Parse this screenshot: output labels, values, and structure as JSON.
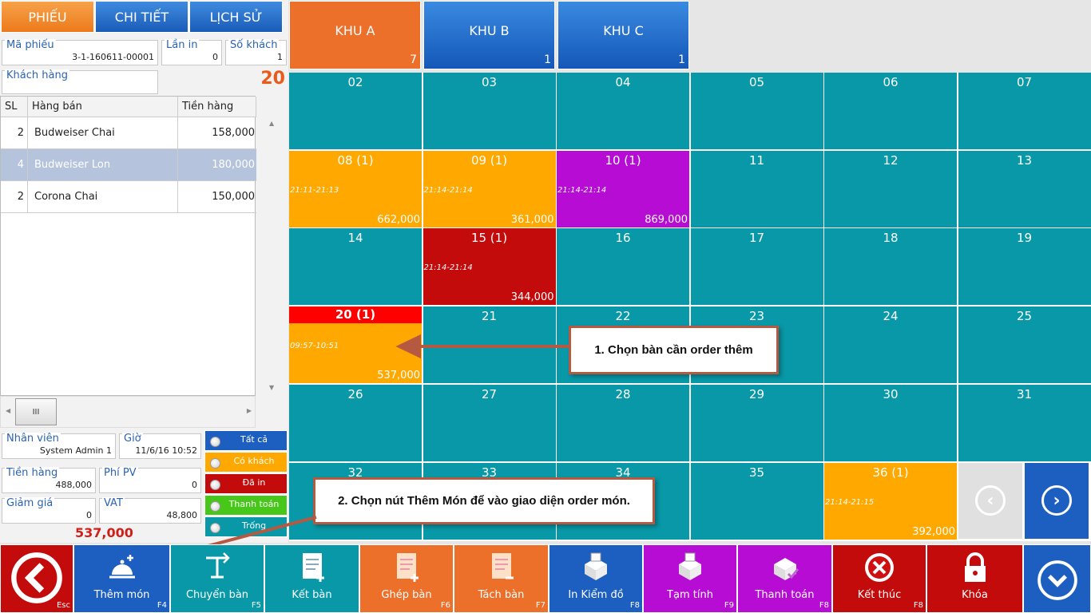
{
  "tabs": [
    {
      "label": "PHIẾU",
      "active": true
    },
    {
      "label": "CHI TIẾT"
    },
    {
      "label": "LỊCH SỬ"
    }
  ],
  "ticket": {
    "ma_phieu_label": "Mã phiếu",
    "ma_phieu": "3-1-160611-00001",
    "lan_in_label": "Lần in",
    "lan_in": "0",
    "so_khach_label": "Số khách",
    "so_khach": "1",
    "khach_hang_label": "Khách hàng",
    "khach_hang": "",
    "table_number": "20"
  },
  "items": {
    "headers": {
      "qty": "SL",
      "name": "Hàng bán",
      "amount": "Tiền hàng"
    },
    "rows": [
      {
        "qty": "2",
        "name": "Budweiser Chai",
        "amount": "158,000"
      },
      {
        "qty": "4",
        "name": "Budweiser Lon",
        "amount": "180,000",
        "selected": true
      },
      {
        "qty": "2",
        "name": "Corona Chai",
        "amount": "150,000"
      }
    ],
    "scroll_handle": "III"
  },
  "summary": {
    "nhan_vien_label": "Nhân viên",
    "nhan_vien": "System Admin 1",
    "gio_label": "Giờ",
    "gio": "11/6/16 10:52",
    "tien_hang_label": "Tiền hàng",
    "tien_hang": "488,000",
    "phi_pv_label": "Phí PV",
    "phi_pv": "0",
    "giam_gia_label": "Giảm giá",
    "giam_gia": "0",
    "vat_label": "VAT",
    "vat": "48,800",
    "total": "537,000"
  },
  "filters": [
    {
      "label": "Tất cả",
      "color": "#1d5fc0"
    },
    {
      "label": "Có khách",
      "color": "#ffa800"
    },
    {
      "label": "Đã in",
      "color": "#c40b0b"
    },
    {
      "label": "Thanh toán",
      "color": "#47c71a"
    },
    {
      "label": "Trống",
      "color": "#0898a8"
    }
  ],
  "zones": [
    {
      "label": "KHU A",
      "count": "7",
      "active": true
    },
    {
      "label": "KHU B",
      "count": "1"
    },
    {
      "label": "KHU C",
      "count": "1"
    }
  ],
  "tables": [
    {
      "name": "02"
    },
    {
      "name": "03"
    },
    {
      "name": "04"
    },
    {
      "name": "05"
    },
    {
      "name": "06"
    },
    {
      "name": "07"
    },
    {
      "name": "08 (1)",
      "time": "21:11-21:13",
      "amount": "662,000",
      "status": "busy"
    },
    {
      "name": "09 (1)",
      "time": "21:14-21:14",
      "amount": "361,000",
      "status": "busy"
    },
    {
      "name": "10 (1)",
      "time": "21:14-21:14",
      "amount": "869,000",
      "status": "purple"
    },
    {
      "name": "11"
    },
    {
      "name": "12"
    },
    {
      "name": "13"
    },
    {
      "name": "14"
    },
    {
      "name": "15 (1)",
      "time": "21:14-21:14",
      "amount": "344,000",
      "status": "red"
    },
    {
      "name": "16"
    },
    {
      "name": "17"
    },
    {
      "name": "18"
    },
    {
      "name": "19"
    },
    {
      "name": "20 (1)",
      "time": "09:57-10:51",
      "amount": "537,000",
      "status": "cur"
    },
    {
      "name": "21"
    },
    {
      "name": "22"
    },
    {
      "name": "23"
    },
    {
      "name": "24"
    },
    {
      "name": "25"
    },
    {
      "name": "26"
    },
    {
      "name": "27"
    },
    {
      "name": "28"
    },
    {
      "name": "29"
    },
    {
      "name": "30"
    },
    {
      "name": "31"
    },
    {
      "name": "32"
    },
    {
      "name": "33"
    },
    {
      "name": "34"
    },
    {
      "name": "35"
    },
    {
      "name": "36 (1)",
      "time": "21:14-21:15",
      "amount": "392,000",
      "status": "busy"
    }
  ],
  "callouts": {
    "one": "1. Chọn bàn cần order thêm",
    "two": "2. Chọn nút Thêm Món để vào giao diện order món."
  },
  "bottom_buttons": [
    {
      "label": "",
      "key": "Esc",
      "color": "#c40b0b",
      "icon": "back-arrow-icon"
    },
    {
      "label": "Thêm món",
      "key": "F4",
      "color": "#1d5fc0",
      "icon": "service-bell-icon"
    },
    {
      "label": "Chuyển bàn",
      "key": "F5",
      "color": "#0898a8",
      "icon": "move-table-icon"
    },
    {
      "label": "Kết bàn",
      "key": "",
      "color": "#0898a8",
      "icon": "document-plus-icon"
    },
    {
      "label": "Ghép bàn",
      "key": "F6",
      "color": "#ec6f2a",
      "icon": "merge-doc-icon"
    },
    {
      "label": "Tách bàn",
      "key": "F7",
      "color": "#ec6f2a",
      "icon": "split-doc-icon"
    },
    {
      "label": "In Kiểm đồ",
      "key": "F8",
      "color": "#1d5fc0",
      "icon": "printer-icon"
    },
    {
      "label": "Tạm tính",
      "key": "F9",
      "color": "#b60cd4",
      "icon": "printer-icon"
    },
    {
      "label": "Thanh toán",
      "key": "F8",
      "color": "#b60cd4",
      "icon": "printer-check-icon"
    },
    {
      "label": "Kết thúc",
      "key": "F8",
      "color": "#c40b0b",
      "icon": "cancel-x-icon"
    },
    {
      "label": "Khóa",
      "key": "",
      "color": "#c40b0b",
      "icon": "lock-icon"
    },
    {
      "label": "",
      "key": "",
      "color": "#1d5fc0",
      "icon": "chevron-down-icon"
    }
  ]
}
